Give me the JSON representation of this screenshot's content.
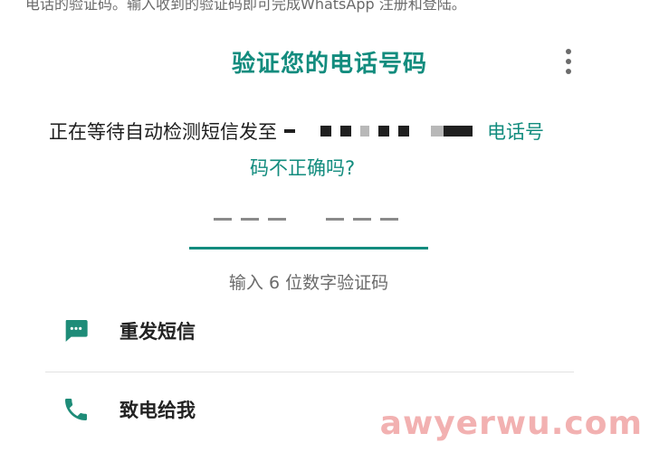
{
  "top_text": "电话的验证码。输入收到的验证码即可完成WhatsApp 注册和登陆。",
  "header": {
    "title": "验证您的电话号码",
    "menu_icon": "more-vert-icon"
  },
  "verify": {
    "waiting_text": "正在等待自动检测短信发至",
    "wrong_number_part1": "电话号",
    "wrong_number_part2": "码不正确吗?",
    "code_hint": "输入 6 位数字验证码"
  },
  "options": [
    {
      "label": "重发短信",
      "icon": "sms-icon"
    },
    {
      "label": "致电给我",
      "icon": "phone-icon"
    }
  ],
  "watermark": "awyerwu.com",
  "colors": {
    "accent": "#128c7e",
    "icon": "#1e8c78",
    "text": "#1f1f1f",
    "secondary": "#6b6b6b"
  }
}
